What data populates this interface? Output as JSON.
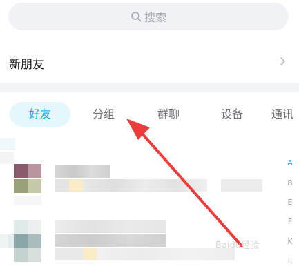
{
  "search": {
    "placeholder": "搜索"
  },
  "new_friends": {
    "label": "新朋友"
  },
  "tabs": [
    {
      "label": "好友"
    },
    {
      "label": "分组"
    },
    {
      "label": "群聊"
    },
    {
      "label": "设备"
    },
    {
      "label": "通讯"
    }
  ],
  "index_letters": [
    "A",
    "B",
    "E",
    "F",
    "K",
    "L"
  ],
  "colors": {
    "accent": "#17a9e5",
    "tab_active_bg": "#e5f6fd",
    "arrow": "#ee3b3b"
  },
  "watermark": "Baidu经验"
}
